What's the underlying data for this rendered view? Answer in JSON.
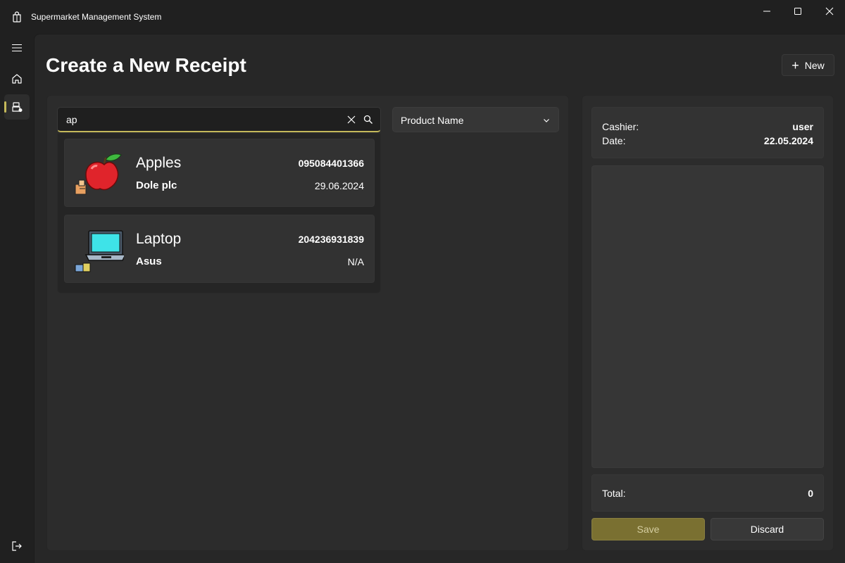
{
  "window": {
    "title": "Supermarket Management System",
    "icons": {
      "app": "shopping-bag-icon",
      "minimize": "minimize-icon",
      "maximize": "maximize-icon",
      "close": "close-icon"
    }
  },
  "nav": {
    "items": [
      {
        "icon": "hamburger-menu-icon"
      },
      {
        "icon": "home-icon"
      },
      {
        "icon": "cash-register-icon",
        "selected": true
      }
    ],
    "footer": {
      "icon": "sign-out-icon"
    },
    "accent": "#c5b95a"
  },
  "page": {
    "title": "Create a New Receipt",
    "new_button_label": "New"
  },
  "search": {
    "value": "ap",
    "results": [
      {
        "name": "Apples",
        "brand": "Dole plc",
        "code": "095084401366",
        "date": "29.06.2024",
        "image": "apple-icon"
      },
      {
        "name": "Laptop",
        "brand": "Asus",
        "code": "204236931839",
        "date": "N/A",
        "image": "laptop-icon"
      }
    ]
  },
  "sort": {
    "selected": "Product Name"
  },
  "receipt": {
    "cashier_label": "Cashier:",
    "cashier_value": "user",
    "date_label": "Date:",
    "date_value": "22.05.2024",
    "total_label": "Total:",
    "total_value": "0",
    "save_label": "Save",
    "discard_label": "Discard"
  }
}
